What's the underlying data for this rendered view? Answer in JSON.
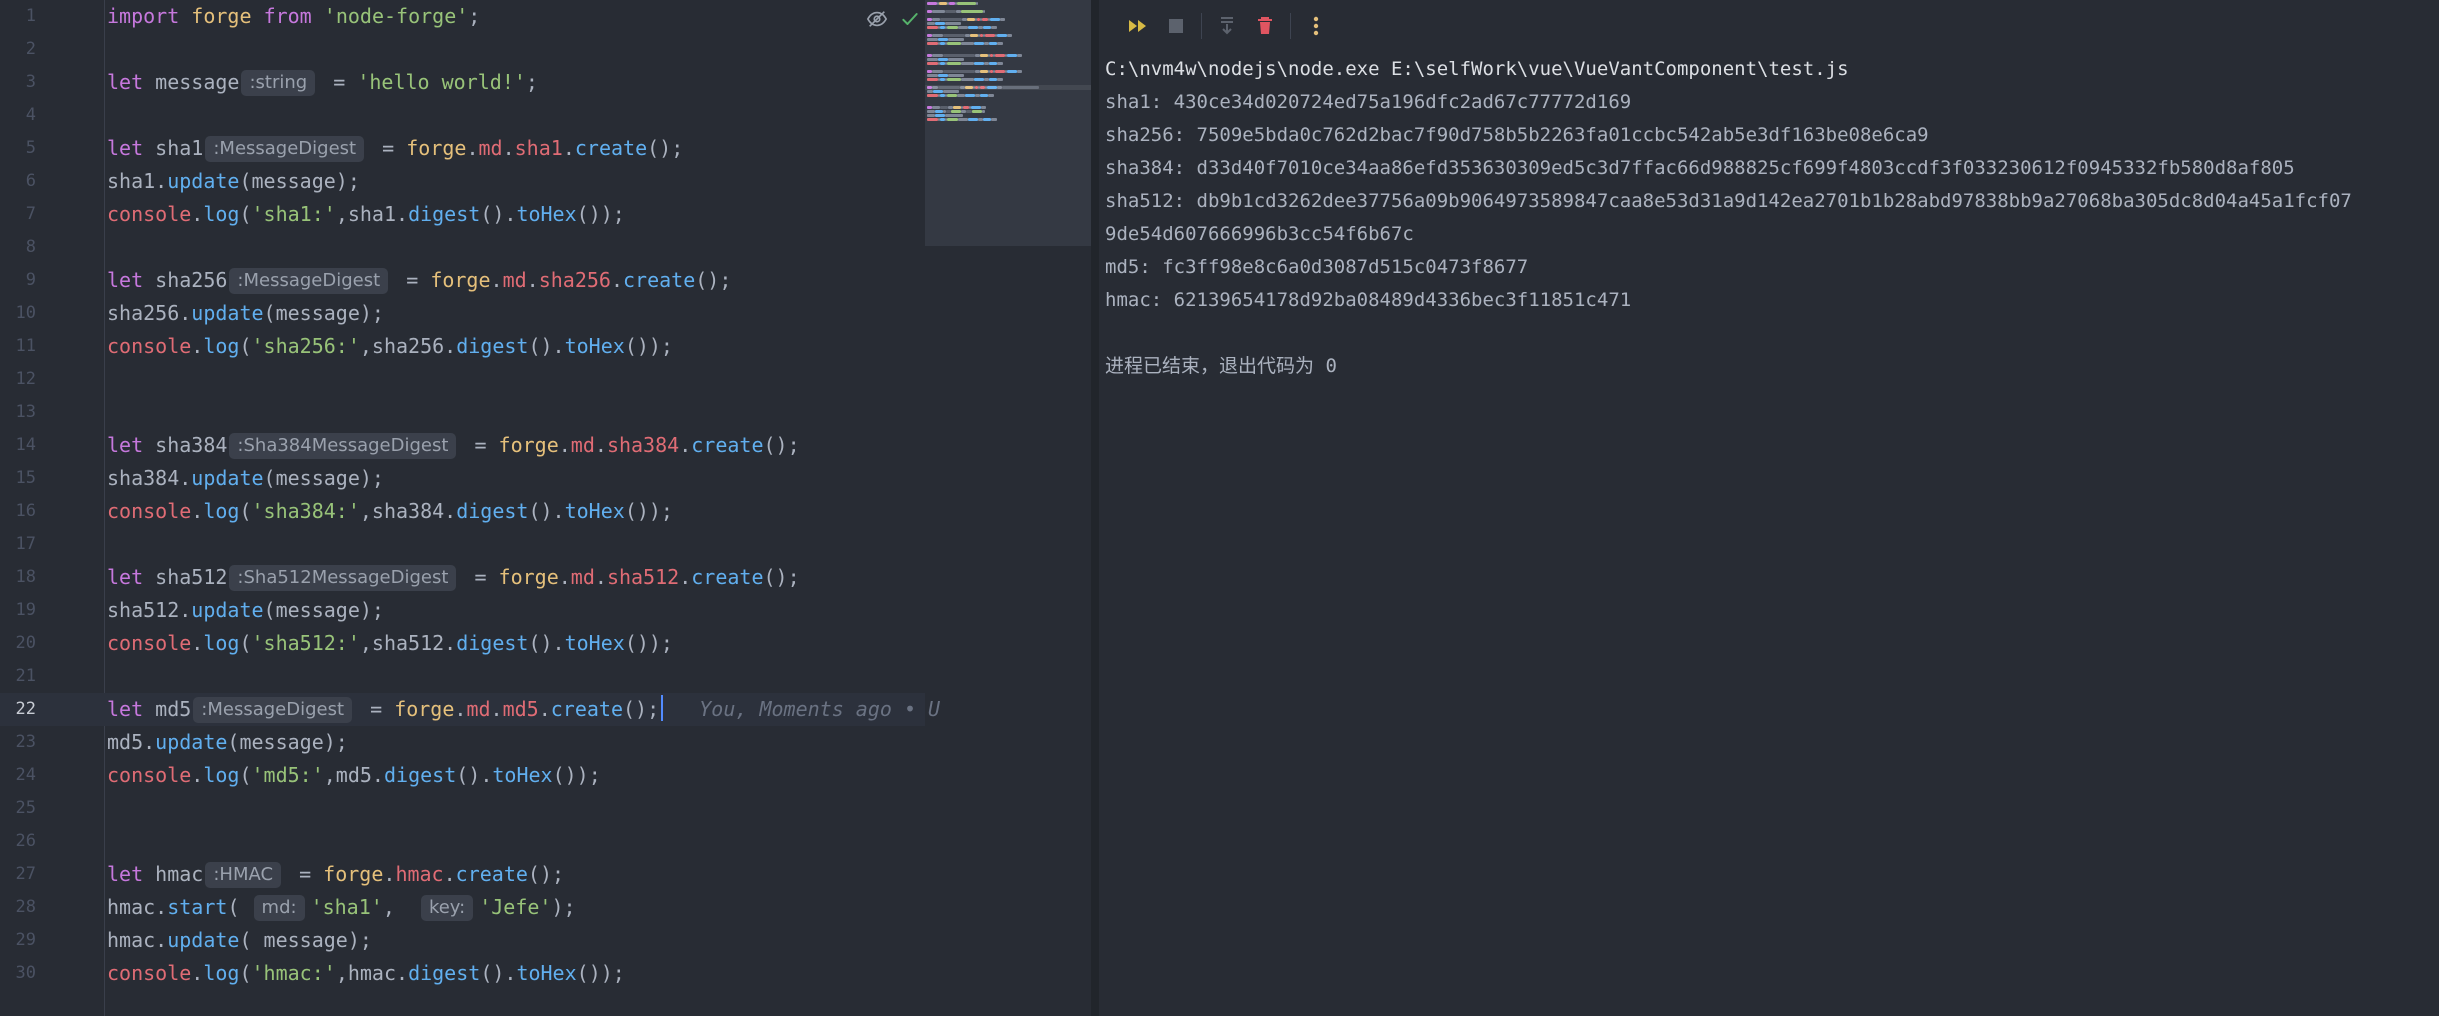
{
  "editor": {
    "lines": [
      {
        "n": "1",
        "tokens": [
          {
            "t": "import",
            "c": "kw"
          },
          {
            "t": " ",
            "c": "plain"
          },
          {
            "t": "forge",
            "c": "obj"
          },
          {
            "t": " ",
            "c": "plain"
          },
          {
            "t": "from",
            "c": "kw"
          },
          {
            "t": " ",
            "c": "plain"
          },
          {
            "t": "'node-forge'",
            "c": "str"
          },
          {
            "t": ";",
            "c": "plain"
          }
        ]
      },
      {
        "n": "2",
        "tokens": []
      },
      {
        "n": "3",
        "tokens": [
          {
            "t": "let",
            "c": "kw"
          },
          {
            "t": " message",
            "c": "plain"
          },
          {
            "hint": ":string"
          },
          {
            "t": " = ",
            "c": "plain"
          },
          {
            "t": "'hello world!'",
            "c": "str"
          },
          {
            "t": ";",
            "c": "plain"
          }
        ]
      },
      {
        "n": "4",
        "tokens": []
      },
      {
        "n": "5",
        "tokens": [
          {
            "t": "let",
            "c": "kw"
          },
          {
            "t": " sha1",
            "c": "plain"
          },
          {
            "hint": ":MessageDigest"
          },
          {
            "t": " = ",
            "c": "plain"
          },
          {
            "t": "forge",
            "c": "obj"
          },
          {
            "t": ".",
            "c": "plain"
          },
          {
            "t": "md",
            "c": "prop"
          },
          {
            "t": ".",
            "c": "plain"
          },
          {
            "t": "sha1",
            "c": "prop"
          },
          {
            "t": ".",
            "c": "plain"
          },
          {
            "t": "create",
            "c": "fn"
          },
          {
            "t": "();",
            "c": "plain"
          }
        ]
      },
      {
        "n": "6",
        "tokens": [
          {
            "t": "sha1.",
            "c": "plain"
          },
          {
            "t": "update",
            "c": "fn"
          },
          {
            "t": "(message);",
            "c": "plain"
          }
        ]
      },
      {
        "n": "7",
        "tokens": [
          {
            "t": "console",
            "c": "kw2"
          },
          {
            "t": ".",
            "c": "plain"
          },
          {
            "t": "log",
            "c": "fn"
          },
          {
            "t": "(",
            "c": "plain"
          },
          {
            "t": "'sha1:'",
            "c": "str"
          },
          {
            "t": ",sha1.",
            "c": "plain"
          },
          {
            "t": "digest",
            "c": "fn"
          },
          {
            "t": "().",
            "c": "plain"
          },
          {
            "t": "toHex",
            "c": "fn"
          },
          {
            "t": "());",
            "c": "plain"
          }
        ]
      },
      {
        "n": "8",
        "tokens": []
      },
      {
        "n": "9",
        "tokens": [
          {
            "t": "let",
            "c": "kw"
          },
          {
            "t": " sha256",
            "c": "plain"
          },
          {
            "hint": ":MessageDigest"
          },
          {
            "t": " = ",
            "c": "plain"
          },
          {
            "t": "forge",
            "c": "obj"
          },
          {
            "t": ".",
            "c": "plain"
          },
          {
            "t": "md",
            "c": "prop"
          },
          {
            "t": ".",
            "c": "plain"
          },
          {
            "t": "sha256",
            "c": "prop"
          },
          {
            "t": ".",
            "c": "plain"
          },
          {
            "t": "create",
            "c": "fn"
          },
          {
            "t": "();",
            "c": "plain"
          }
        ]
      },
      {
        "n": "10",
        "tokens": [
          {
            "t": "sha256.",
            "c": "plain"
          },
          {
            "t": "update",
            "c": "fn"
          },
          {
            "t": "(message);",
            "c": "plain"
          }
        ]
      },
      {
        "n": "11",
        "tokens": [
          {
            "t": "console",
            "c": "kw2"
          },
          {
            "t": ".",
            "c": "plain"
          },
          {
            "t": "log",
            "c": "fn"
          },
          {
            "t": "(",
            "c": "plain"
          },
          {
            "t": "'sha256:'",
            "c": "str"
          },
          {
            "t": ",sha256.",
            "c": "plain"
          },
          {
            "t": "digest",
            "c": "fn"
          },
          {
            "t": "().",
            "c": "plain"
          },
          {
            "t": "toHex",
            "c": "fn"
          },
          {
            "t": "());",
            "c": "plain"
          }
        ]
      },
      {
        "n": "12",
        "tokens": []
      },
      {
        "n": "13",
        "tokens": []
      },
      {
        "n": "14",
        "tokens": [
          {
            "t": "let",
            "c": "kw"
          },
          {
            "t": " sha384",
            "c": "plain"
          },
          {
            "hint": ":Sha384MessageDigest"
          },
          {
            "t": " = ",
            "c": "plain"
          },
          {
            "t": "forge",
            "c": "obj"
          },
          {
            "t": ".",
            "c": "plain"
          },
          {
            "t": "md",
            "c": "prop"
          },
          {
            "t": ".",
            "c": "plain"
          },
          {
            "t": "sha384",
            "c": "prop"
          },
          {
            "t": ".",
            "c": "plain"
          },
          {
            "t": "create",
            "c": "fn"
          },
          {
            "t": "();",
            "c": "plain"
          }
        ]
      },
      {
        "n": "15",
        "tokens": [
          {
            "t": "sha384.",
            "c": "plain"
          },
          {
            "t": "update",
            "c": "fn"
          },
          {
            "t": "(message);",
            "c": "plain"
          }
        ]
      },
      {
        "n": "16",
        "tokens": [
          {
            "t": "console",
            "c": "kw2"
          },
          {
            "t": ".",
            "c": "plain"
          },
          {
            "t": "log",
            "c": "fn"
          },
          {
            "t": "(",
            "c": "plain"
          },
          {
            "t": "'sha384:'",
            "c": "str"
          },
          {
            "t": ",sha384.",
            "c": "plain"
          },
          {
            "t": "digest",
            "c": "fn"
          },
          {
            "t": "().",
            "c": "plain"
          },
          {
            "t": "toHex",
            "c": "fn"
          },
          {
            "t": "());",
            "c": "plain"
          }
        ]
      },
      {
        "n": "17",
        "tokens": []
      },
      {
        "n": "18",
        "tokens": [
          {
            "t": "let",
            "c": "kw"
          },
          {
            "t": " sha512",
            "c": "plain"
          },
          {
            "hint": ":Sha512MessageDigest"
          },
          {
            "t": " = ",
            "c": "plain"
          },
          {
            "t": "forge",
            "c": "obj"
          },
          {
            "t": ".",
            "c": "plain"
          },
          {
            "t": "md",
            "c": "prop"
          },
          {
            "t": ".",
            "c": "plain"
          },
          {
            "t": "sha512",
            "c": "prop"
          },
          {
            "t": ".",
            "c": "plain"
          },
          {
            "t": "create",
            "c": "fn"
          },
          {
            "t": "();",
            "c": "plain"
          }
        ]
      },
      {
        "n": "19",
        "tokens": [
          {
            "t": "sha512.",
            "c": "plain"
          },
          {
            "t": "update",
            "c": "fn"
          },
          {
            "t": "(message);",
            "c": "plain"
          }
        ]
      },
      {
        "n": "20",
        "tokens": [
          {
            "t": "console",
            "c": "kw2"
          },
          {
            "t": ".",
            "c": "plain"
          },
          {
            "t": "log",
            "c": "fn"
          },
          {
            "t": "(",
            "c": "plain"
          },
          {
            "t": "'sha512:'",
            "c": "str"
          },
          {
            "t": ",sha512.",
            "c": "plain"
          },
          {
            "t": "digest",
            "c": "fn"
          },
          {
            "t": "().",
            "c": "plain"
          },
          {
            "t": "toHex",
            "c": "fn"
          },
          {
            "t": "());",
            "c": "plain"
          }
        ]
      },
      {
        "n": "21",
        "tokens": []
      },
      {
        "n": "22",
        "current": true,
        "tokens": [
          {
            "t": "let",
            "c": "kw"
          },
          {
            "t": " md5",
            "c": "plain"
          },
          {
            "hint": ":MessageDigest"
          },
          {
            "t": " = ",
            "c": "plain"
          },
          {
            "t": "forge",
            "c": "obj"
          },
          {
            "t": ".",
            "c": "plain"
          },
          {
            "t": "md",
            "c": "prop"
          },
          {
            "t": ".",
            "c": "plain"
          },
          {
            "t": "md5",
            "c": "prop"
          },
          {
            "t": ".",
            "c": "plain"
          },
          {
            "t": "create",
            "c": "fn"
          },
          {
            "t": "();",
            "c": "plain"
          },
          {
            "caret": true
          },
          {
            "t": "   You, Moments ago • U",
            "c": "blame"
          }
        ]
      },
      {
        "n": "23",
        "tokens": [
          {
            "t": "md5.",
            "c": "plain"
          },
          {
            "t": "update",
            "c": "fn"
          },
          {
            "t": "(message);",
            "c": "plain"
          }
        ]
      },
      {
        "n": "24",
        "tokens": [
          {
            "t": "console",
            "c": "kw2"
          },
          {
            "t": ".",
            "c": "plain"
          },
          {
            "t": "log",
            "c": "fn"
          },
          {
            "t": "(",
            "c": "plain"
          },
          {
            "t": "'md5:'",
            "c": "str"
          },
          {
            "t": ",md5.",
            "c": "plain"
          },
          {
            "t": "digest",
            "c": "fn"
          },
          {
            "t": "().",
            "c": "plain"
          },
          {
            "t": "toHex",
            "c": "fn"
          },
          {
            "t": "());",
            "c": "plain"
          }
        ]
      },
      {
        "n": "25",
        "tokens": []
      },
      {
        "n": "26",
        "tokens": []
      },
      {
        "n": "27",
        "tokens": [
          {
            "t": "let",
            "c": "kw"
          },
          {
            "t": " hmac",
            "c": "plain"
          },
          {
            "hint": ":HMAC"
          },
          {
            "t": " = ",
            "c": "plain"
          },
          {
            "t": "forge",
            "c": "obj"
          },
          {
            "t": ".",
            "c": "plain"
          },
          {
            "t": "hmac",
            "c": "prop"
          },
          {
            "t": ".",
            "c": "plain"
          },
          {
            "t": "create",
            "c": "fn"
          },
          {
            "t": "();",
            "c": "plain"
          }
        ]
      },
      {
        "n": "28",
        "tokens": [
          {
            "t": "hmac.",
            "c": "plain"
          },
          {
            "t": "start",
            "c": "fn"
          },
          {
            "t": "( ",
            "c": "plain"
          },
          {
            "hint": "md:"
          },
          {
            "t": "'sha1'",
            "c": "str"
          },
          {
            "t": ",  ",
            "c": "plain"
          },
          {
            "hint": "key:"
          },
          {
            "t": "'Jefe'",
            "c": "str"
          },
          {
            "t": ");",
            "c": "plain"
          }
        ]
      },
      {
        "n": "29",
        "tokens": [
          {
            "t": "hmac.",
            "c": "plain"
          },
          {
            "t": "update",
            "c": "fn"
          },
          {
            "t": "( message);",
            "c": "plain"
          }
        ]
      },
      {
        "n": "30",
        "tokens": [
          {
            "t": "console",
            "c": "kw2"
          },
          {
            "t": ".",
            "c": "plain"
          },
          {
            "t": "log",
            "c": "fn"
          },
          {
            "t": "(",
            "c": "plain"
          },
          {
            "t": "'hmac:'",
            "c": "str"
          },
          {
            "t": ",hmac.",
            "c": "plain"
          },
          {
            "t": "digest",
            "c": "fn"
          },
          {
            "t": "().",
            "c": "plain"
          },
          {
            "t": "toHex",
            "c": "fn"
          },
          {
            "t": "());",
            "c": "plain"
          }
        ]
      }
    ],
    "icons": [
      "eye-off-icon",
      "check-icon"
    ]
  },
  "run": {
    "toolbar": [
      {
        "name": "rerun-button",
        "icon": "fast-forward-icon"
      },
      {
        "name": "stop-button",
        "icon": "stop-icon"
      },
      {
        "name": "scroll-to-end-button",
        "icon": "scroll-down-icon"
      },
      {
        "name": "clear-output-button",
        "icon": "trash-icon"
      },
      {
        "name": "more-options-button",
        "icon": "more-vertical-icon"
      }
    ],
    "output": [
      {
        "text": "C:\\nvm4w\\nodejs\\node.exe E:\\selfWork\\vue\\VueVantComponent\\test.js",
        "kind": "cmd"
      },
      {
        "text": "sha1: 430ce34d020724ed75a196dfc2ad67c77772d169",
        "kind": "out"
      },
      {
        "text": "sha256: 7509e5bda0c762d2bac7f90d758b5b2263fa01ccbc542ab5e3df163be08e6ca9",
        "kind": "out"
      },
      {
        "text": "sha384: d33d40f7010ce34aa86efd353630309ed5c3d7ffac66d988825cf699f4803ccdf3f033230612f0945332fb580d8af805",
        "kind": "out"
      },
      {
        "text": "sha512: db9b1cd3262dee37756a09b9064973589847caa8e53d31a9d142ea2701b1b28abd97838bb9a27068ba305dc8d04a45a1fcf07",
        "kind": "out"
      },
      {
        "text": "9de54d607666996b3cc54f6b67c",
        "kind": "out"
      },
      {
        "text": "md5: fc3ff98e8c6a0d3087d515c0473f8677",
        "kind": "out"
      },
      {
        "text": "hmac: 62139654178d92ba08489d4336bec3f11851c471",
        "kind": "out"
      },
      {
        "text": "",
        "kind": "blank"
      },
      {
        "text": "进程已结束，退出代码为 0",
        "kind": "exit"
      }
    ]
  },
  "colors": {
    "keyword": "#c678dd",
    "console": "#e06c75",
    "string": "#98c379",
    "function": "#61afef",
    "object": "#e5c07b",
    "delete": "#e05561",
    "run": "#d7ba45",
    "more": "#e5c07b"
  }
}
